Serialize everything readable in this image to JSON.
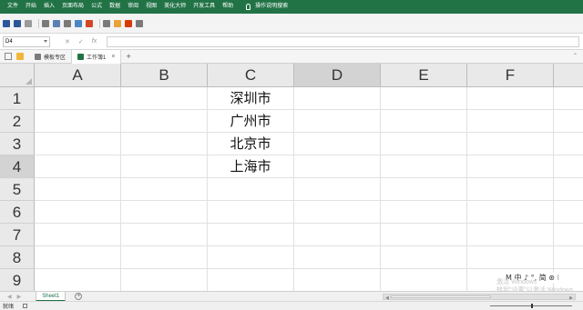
{
  "menubar": {
    "items": [
      "文件",
      "开始",
      "插入",
      "页面布局",
      "公式",
      "数据",
      "审阅",
      "视图",
      "美化大师",
      "开发工具",
      "帮助"
    ],
    "search_label": "操作说明搜索"
  },
  "toolbar": {
    "icons": [
      {
        "name": "save-icon",
        "color": "#2b579a"
      },
      {
        "name": "undo-icon",
        "color": "#2b579a"
      },
      {
        "name": "redo-icon",
        "color": "#9b9b9b"
      },
      {
        "name": "screenshot-icon",
        "color": "#7a7a7a"
      },
      {
        "name": "print-preview-icon",
        "color": "#5a7fb5"
      },
      {
        "name": "spellcheck-icon",
        "color": "#7a7a7a"
      },
      {
        "name": "table-icon",
        "color": "#4a86c5"
      },
      {
        "name": "chart-icon",
        "color": "#d24726"
      },
      {
        "name": "zoom-icon",
        "color": "#7a7a7a"
      },
      {
        "name": "format-icon",
        "color": "#e8a33a"
      },
      {
        "name": "color-icon",
        "color": "#d83b01"
      },
      {
        "name": "more-icon",
        "color": "#7a7a7a"
      }
    ]
  },
  "formulabar": {
    "namebox_value": "D4",
    "cancel_glyph": "✕",
    "confirm_glyph": "✓",
    "fx_glyph": "fx",
    "formula_value": ""
  },
  "doctabs": {
    "tabs": [
      {
        "label": "模板专区",
        "active": false,
        "icon_color": "#7a7a7a"
      },
      {
        "label": "工作簿1",
        "active": true,
        "icon_color": "#217346",
        "close": "×"
      }
    ],
    "plus": "+"
  },
  "grid": {
    "columns": [
      "A",
      "B",
      "C",
      "D",
      "E",
      "F"
    ],
    "selected_column": "D",
    "rows": [
      "1",
      "2",
      "3",
      "4",
      "5",
      "6",
      "7",
      "8",
      "9"
    ],
    "selected_row": "4",
    "cells": {
      "C1": "深圳市",
      "C2": "广州市",
      "C3": "北京市",
      "C4": "上海市"
    }
  },
  "ime": "M 中 ♪ °, 简 ⊛ ⁝",
  "watermark": [
    "激活 Windows",
    "转到\"设置\"以激活 Windows"
  ],
  "sheetbar": {
    "sheets": [
      "Sheet1"
    ],
    "add_label": "+"
  },
  "statusbar": {
    "status": "就绪"
  }
}
